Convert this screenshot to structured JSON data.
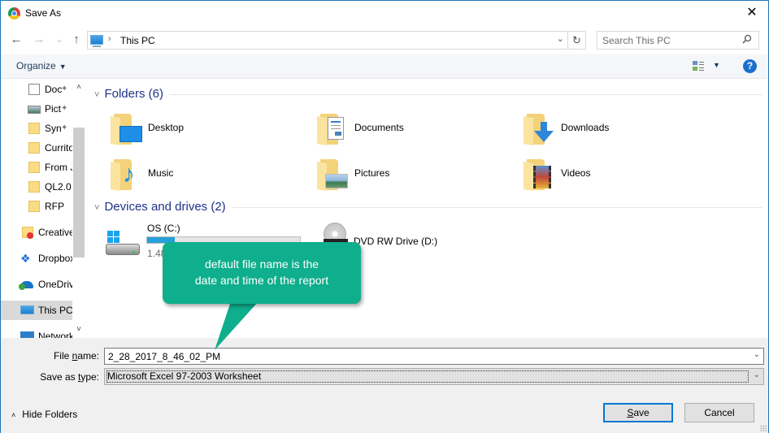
{
  "window": {
    "title": "Save As",
    "close_label": "✕"
  },
  "navigation": {
    "back_icon": "←",
    "forward_icon": "→",
    "recent_icon": "⌄",
    "up_icon": "↑",
    "breadcrumb": [
      "This PC"
    ],
    "breadcrumb_separator": "›",
    "address_dropdown_icon": "⌄",
    "refresh_icon": "↻",
    "search_placeholder": "Search This PC",
    "search_icon": "⚲"
  },
  "toolbar": {
    "organize_label": "Organize",
    "organize_caret": "▼",
    "view_caret": "▼",
    "help_label": "?"
  },
  "sidebar": {
    "items": [
      {
        "label": "Documents",
        "display": "Doc",
        "icon": "documents-icon",
        "pinned": true
      },
      {
        "label": "Pictures",
        "display": "Pict",
        "icon": "pictures-icon",
        "pinned": true
      },
      {
        "label": "Syn",
        "display": "Syn",
        "icon": "folder-icon",
        "pinned": true
      },
      {
        "label": "Currito",
        "display": "Currito",
        "icon": "folder-icon",
        "pinned": false
      },
      {
        "label": "From J",
        "display": "From J",
        "icon": "folder-icon",
        "pinned": false
      },
      {
        "label": "QL2.0",
        "display": "QL2.0",
        "icon": "folder-icon",
        "pinned": false
      },
      {
        "label": "RFP",
        "display": "RFP",
        "icon": "folder-icon",
        "pinned": false
      },
      {
        "label": "Creative Cloud Files",
        "display": "Creative",
        "icon": "creative-cloud-icon",
        "pinned": false
      },
      {
        "label": "Dropbox",
        "display": "Dropbox",
        "icon": "dropbox-icon",
        "pinned": false
      },
      {
        "label": "OneDrive",
        "display": "OneDrive",
        "icon": "onedrive-icon",
        "pinned": false
      },
      {
        "label": "This PC",
        "display": "This PC",
        "icon": "this-pc-icon",
        "pinned": false,
        "selected": true
      },
      {
        "label": "Network",
        "display": "Network",
        "icon": "network-icon",
        "pinned": false
      }
    ],
    "pin_glyph": "📌",
    "scroll_up": "˄",
    "scroll_down": "˅"
  },
  "main": {
    "folders_group": {
      "title": "Folders (6)",
      "chevron": "˅",
      "items": [
        {
          "label": "Desktop",
          "icon": "desktop-icon"
        },
        {
          "label": "Documents",
          "icon": "documents-icon"
        },
        {
          "label": "Downloads",
          "icon": "downloads-icon"
        },
        {
          "label": "Music",
          "icon": "music-icon"
        },
        {
          "label": "Pictures",
          "icon": "pictures-icon"
        },
        {
          "label": "Videos",
          "icon": "videos-icon"
        }
      ]
    },
    "devices_group": {
      "title": "Devices and drives (2)",
      "chevron": "˅",
      "drives": [
        {
          "label": "OS (C:)",
          "free_text": "1.48",
          "used_fraction": 0.18,
          "icon": "hard-drive-icon"
        },
        {
          "label": "DVD RW Drive (D:)",
          "icon": "dvd-drive-icon"
        }
      ]
    }
  },
  "form": {
    "file_name_label_pre": "File ",
    "file_name_label_ul": "n",
    "file_name_label_post": "ame:",
    "file_name_value": "2_28_2017_8_46_02_PM",
    "save_type_label_pre": "Save as ",
    "save_type_label_ul": "t",
    "save_type_label_post": "ype:",
    "save_type_value": "Microsoft Excel 97-2003 Worksheet",
    "dropdown_icon": "⌄",
    "hide_folders_label": "Hide Folders",
    "hide_folders_chevron": "˄",
    "save_button_ul": "S",
    "save_button_rest": "ave",
    "cancel_button": "Cancel"
  },
  "annotation": {
    "line1": "default file name is the",
    "line2": "date and time of the report",
    "color": "#0fae8d"
  }
}
